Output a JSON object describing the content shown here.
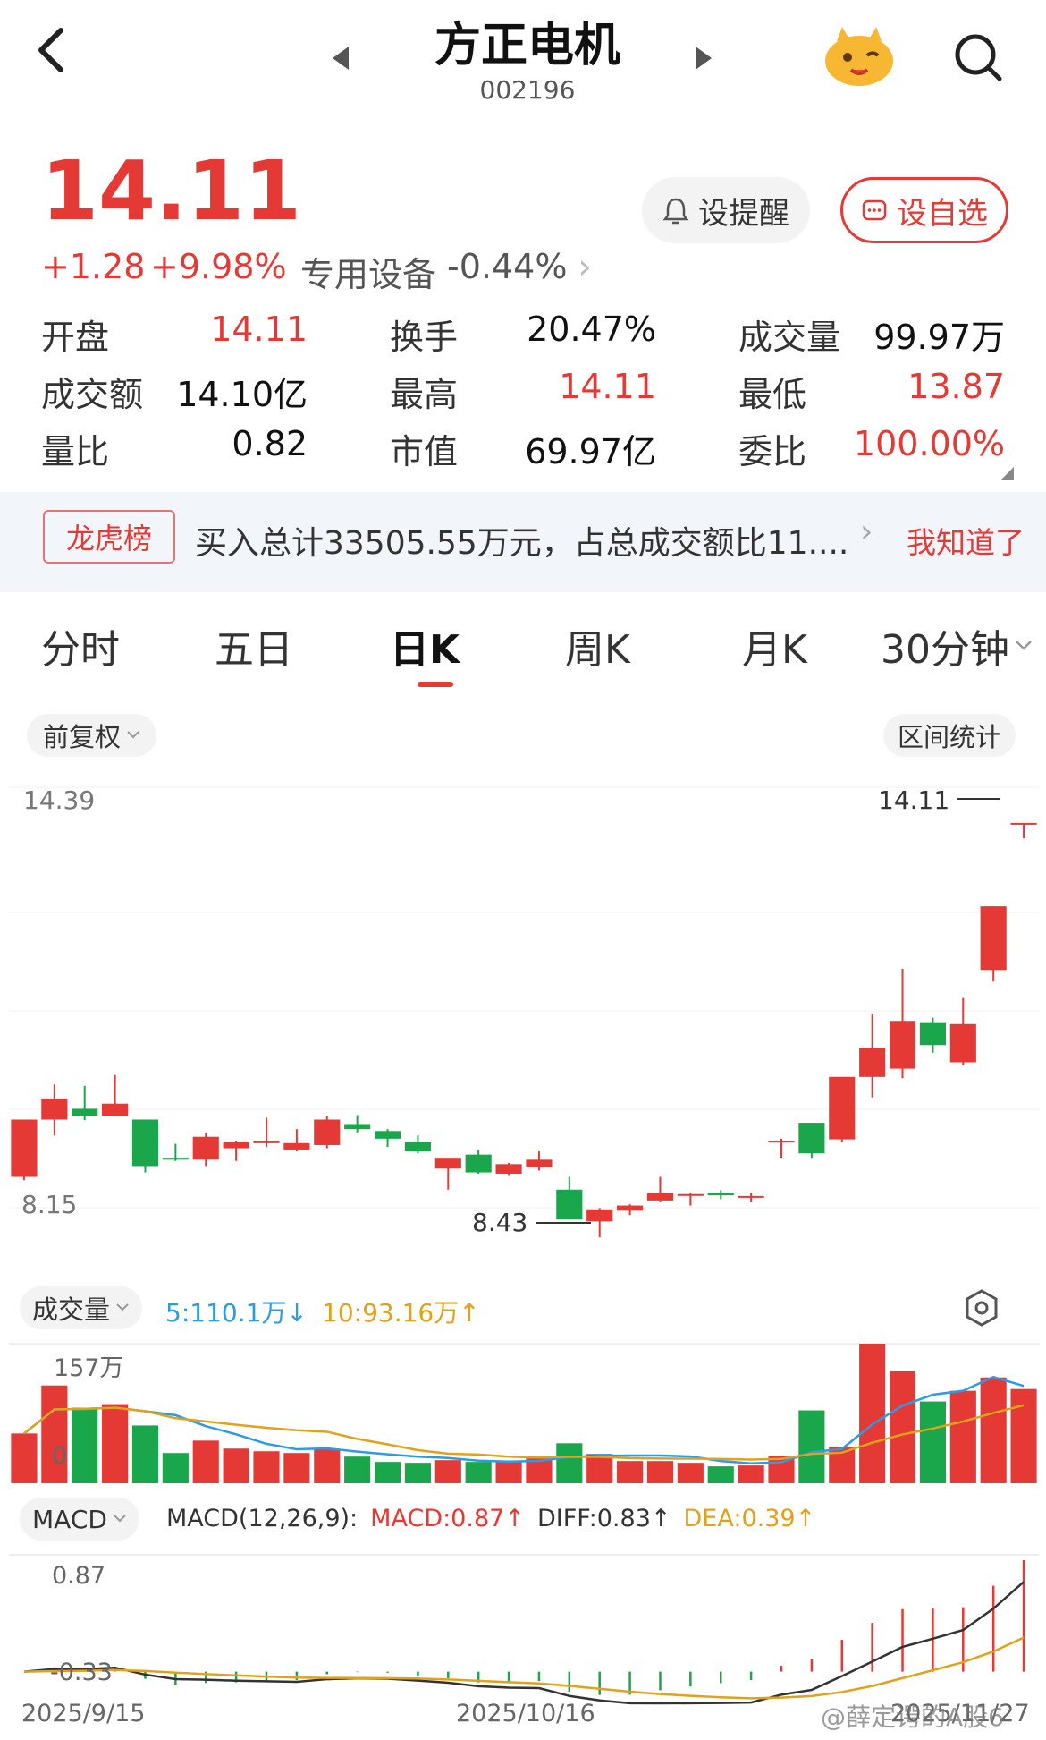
{
  "header": {
    "title": "方正电机",
    "code": "002196"
  },
  "quote": {
    "price": "14.11",
    "change": "+1.28",
    "change_pct": "+9.98%",
    "sector": "专用设备",
    "sector_pct": "-0.44%",
    "sector_arrow": "›"
  },
  "buttons": {
    "alert": "设提醒",
    "watch": "设自选"
  },
  "stats": [
    {
      "label": "开盘",
      "value": "14.11",
      "color": "#e53935"
    },
    {
      "label": "换手",
      "value": "20.47%",
      "color": "#111"
    },
    {
      "label": "成交量",
      "value": "99.97万",
      "color": "#111"
    },
    {
      "label": "成交额",
      "value": "14.10亿",
      "color": "#111"
    },
    {
      "label": "最高",
      "value": "14.11",
      "color": "#e53935"
    },
    {
      "label": "最低",
      "value": "13.87",
      "color": "#e53935"
    },
    {
      "label": "量比",
      "value": "0.82",
      "color": "#111"
    },
    {
      "label": "市值",
      "value": "69.97亿",
      "color": "#111"
    },
    {
      "label": "委比",
      "value": "100.00%",
      "color": "#e53935"
    }
  ],
  "banner": {
    "tag": "龙虎榜",
    "text": "买入总计33505.55万元，占总成交额比11....",
    "arrow": "›",
    "dismiss": "我知道了"
  },
  "tabs": [
    "分时",
    "五日",
    "日K",
    "周K",
    "月K",
    "30分钟"
  ],
  "active_tab": "日K",
  "kline": {
    "adjust": "前复权",
    "range_stats": "区间统计",
    "y_top": "14.39",
    "y_bottom": "8.15",
    "high_label": "14.11",
    "low_label": "8.43"
  },
  "volume": {
    "label": "成交量",
    "ma5": "5:110.1万",
    "ma5_arrow": "↓",
    "ma10": "10:93.16万",
    "ma10_arrow": "↑",
    "y_top": "157万",
    "y_bottom": "0"
  },
  "macd": {
    "label": "MACD",
    "params": "MACD(12,26,9):",
    "macd": "MACD:0.87",
    "macd_arrow": "↑",
    "diff": "DIFF:0.83",
    "diff_arrow": "↑",
    "dea": "DEA:0.39",
    "dea_arrow": "↑",
    "y_top": "0.87",
    "y_bottom": "-0.33"
  },
  "dates": [
    "2025/9/15",
    "2025/10/16",
    "2025/11/27"
  ],
  "watermark": "@薛定谔的A股6",
  "colors": {
    "up": "#e53935",
    "down": "#1aa64a",
    "ma5": "#2b9be8",
    "ma10": "#e0a21a",
    "dif": "#333333",
    "dea": "#e0a21a"
  },
  "chart_data": {
    "type": "candlestick",
    "candles": [
      {
        "o": 8.55,
        "c": 9.45,
        "h": 9.45,
        "l": 8.5
      },
      {
        "o": 9.45,
        "c": 9.78,
        "h": 10.0,
        "l": 9.2
      },
      {
        "o": 9.62,
        "c": 9.5,
        "h": 9.98,
        "l": 9.44
      },
      {
        "o": 9.5,
        "c": 9.7,
        "h": 10.15,
        "l": 9.5
      },
      {
        "o": 9.45,
        "c": 8.72,
        "h": 9.45,
        "l": 8.62
      },
      {
        "o": 8.85,
        "c": 8.82,
        "h": 9.07,
        "l": 8.8
      },
      {
        "o": 8.82,
        "c": 9.18,
        "h": 9.24,
        "l": 8.72
      },
      {
        "o": 9.0,
        "c": 9.1,
        "h": 9.12,
        "l": 8.8
      },
      {
        "o": 9.08,
        "c": 9.12,
        "h": 9.48,
        "l": 9.02
      },
      {
        "o": 8.98,
        "c": 9.08,
        "h": 9.3,
        "l": 8.95
      },
      {
        "o": 9.05,
        "c": 9.45,
        "h": 9.5,
        "l": 9.0
      },
      {
        "o": 9.38,
        "c": 9.3,
        "h": 9.52,
        "l": 9.25
      },
      {
        "o": 9.27,
        "c": 9.15,
        "h": 9.3,
        "l": 9.02
      },
      {
        "o": 9.1,
        "c": 8.95,
        "h": 9.2,
        "l": 8.92
      },
      {
        "o": 8.68,
        "c": 8.85,
        "h": 8.85,
        "l": 8.35
      },
      {
        "o": 8.9,
        "c": 8.62,
        "h": 8.98,
        "l": 8.6
      },
      {
        "o": 8.6,
        "c": 8.75,
        "h": 8.77,
        "l": 8.58
      },
      {
        "o": 8.7,
        "c": 8.82,
        "h": 8.95,
        "l": 8.65
      },
      {
        "o": 8.35,
        "c": 7.88,
        "h": 8.55,
        "l": 7.88
      },
      {
        "o": 7.85,
        "c": 8.04,
        "h": 8.06,
        "l": 7.6
      },
      {
        "o": 8.02,
        "c": 8.1,
        "h": 8.12,
        "l": 7.95
      },
      {
        "o": 8.18,
        "c": 8.3,
        "h": 8.55,
        "l": 8.15
      },
      {
        "o": 8.28,
        "c": 8.28,
        "h": 8.3,
        "l": 8.1
      },
      {
        "o": 8.3,
        "c": 8.26,
        "h": 8.34,
        "l": 8.2
      },
      {
        "o": 8.25,
        "c": 8.25,
        "h": 8.3,
        "l": 8.15
      },
      {
        "o": 9.1,
        "c": 9.12,
        "h": 9.15,
        "l": 8.85
      },
      {
        "o": 9.4,
        "c": 8.92,
        "h": 9.4,
        "l": 8.85
      },
      {
        "o": 9.14,
        "c": 10.12,
        "h": 10.12,
        "l": 9.1
      },
      {
        "o": 10.12,
        "c": 10.58,
        "h": 11.1,
        "l": 9.8
      },
      {
        "o": 10.25,
        "c": 11.0,
        "h": 11.82,
        "l": 10.1
      },
      {
        "o": 10.98,
        "c": 10.62,
        "h": 11.05,
        "l": 10.5
      },
      {
        "o": 10.35,
        "c": 10.95,
        "h": 11.36,
        "l": 10.3
      },
      {
        "o": 11.8,
        "c": 12.8,
        "h": 12.8,
        "l": 11.62
      },
      {
        "o": 14.11,
        "c": 14.11,
        "h": 14.11,
        "l": 13.87
      }
    ],
    "volumes": [
      56,
      110,
      85,
      89,
      65,
      34,
      48,
      39,
      36,
      34,
      39,
      30,
      24,
      23,
      26,
      24,
      25,
      28,
      45,
      33,
      25,
      25,
      23,
      19,
      20,
      31,
      82,
      41,
      157,
      126,
      92,
      104,
      119,
      106
    ]
  }
}
